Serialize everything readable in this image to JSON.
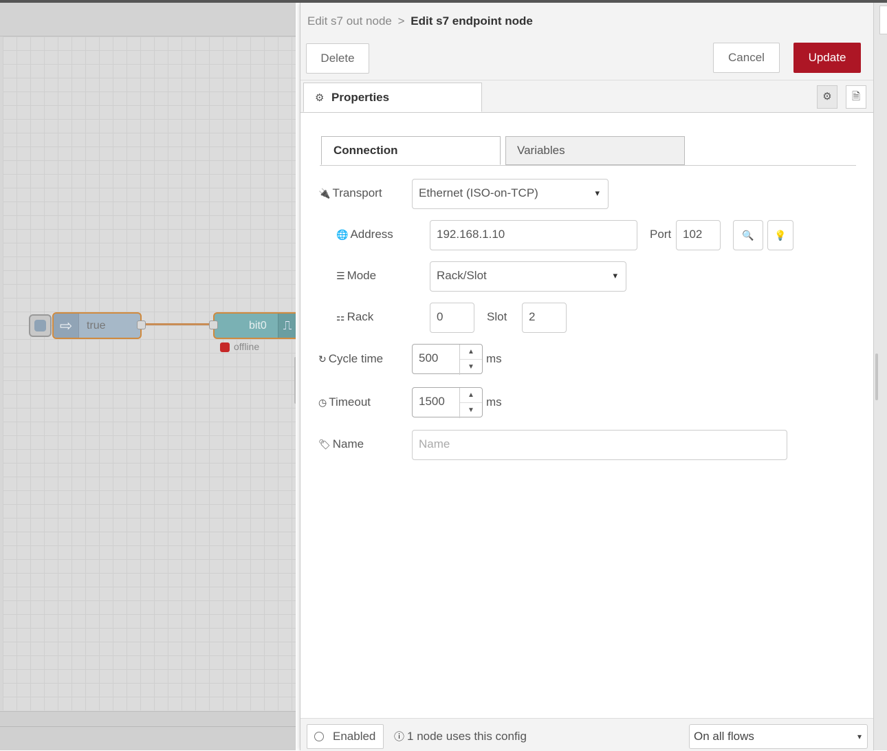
{
  "workspace": {
    "inject_node": {
      "label": "true",
      "icon": "arrow-right-icon"
    },
    "s7_node": {
      "label": "bit0",
      "icon": "pulse-icon",
      "status": "offline",
      "status_color": "#c62828"
    }
  },
  "tray": {
    "breadcrumb": {
      "parent": "Edit s7 out node",
      "separator": ">",
      "current": "Edit s7 endpoint node"
    },
    "buttons": {
      "delete": "Delete",
      "cancel": "Cancel",
      "update": "Update"
    },
    "tabs": {
      "properties": "Properties"
    },
    "subtabs": {
      "connection": "Connection",
      "variables": "Variables"
    },
    "form": {
      "transport": {
        "label": "Transport",
        "value": "Ethernet (ISO-on-TCP)"
      },
      "address": {
        "label": "Address",
        "value": "192.168.1.10"
      },
      "port": {
        "label": "Port",
        "value": "102"
      },
      "mode": {
        "label": "Mode",
        "value": "Rack/Slot"
      },
      "rack": {
        "label": "Rack",
        "value": "0"
      },
      "slot": {
        "label": "Slot",
        "value": "2"
      },
      "cycle_time": {
        "label": "Cycle time",
        "value": "500",
        "unit": "ms"
      },
      "timeout": {
        "label": "Timeout",
        "value": "1500",
        "unit": "ms"
      },
      "name": {
        "label": "Name",
        "value": "",
        "placeholder": "Name"
      }
    },
    "footer": {
      "enabled": "Enabled",
      "usage": "1 node uses this config",
      "scope": "On all flows"
    }
  },
  "colors": {
    "accent_update": "#ad1625",
    "wire": "#c98d55",
    "s7_node": "#7ab1b4",
    "inject_node": "#a6b8c8"
  }
}
